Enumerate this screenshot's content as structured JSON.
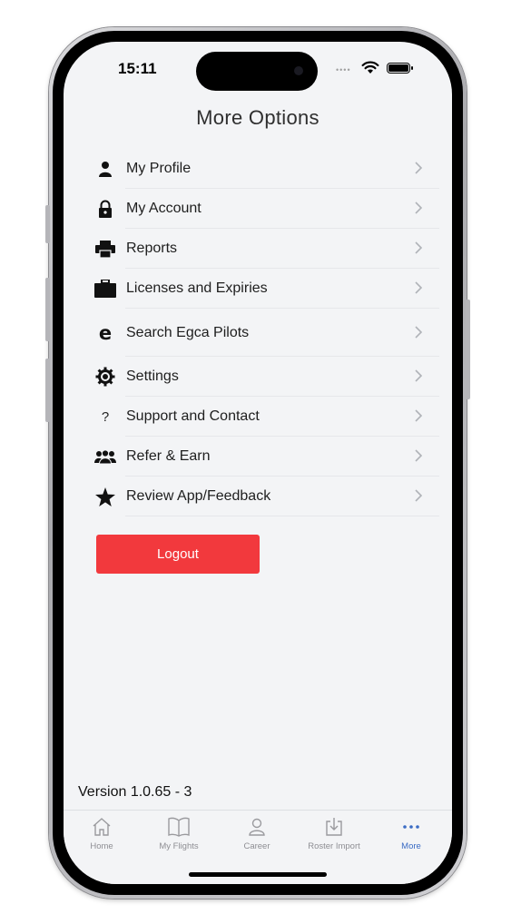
{
  "status_bar": {
    "time": "15:11",
    "signal": "••••"
  },
  "page": {
    "title": "More Options"
  },
  "menu": [
    {
      "label": "My Profile",
      "icon": "person-icon"
    },
    {
      "label": "My Account",
      "icon": "lock-icon"
    },
    {
      "label": "Reports",
      "icon": "printer-icon"
    },
    {
      "label": "Licenses and Expiries",
      "icon": "briefcase-icon"
    },
    {
      "label": "Search Egca Pilots",
      "icon": "egca-icon",
      "icon_text": "e"
    },
    {
      "label": "Settings",
      "icon": "gear-icon"
    },
    {
      "label": "Support and Contact",
      "icon": "question-icon",
      "icon_text": "?"
    },
    {
      "label": "Refer & Earn",
      "icon": "group-icon"
    },
    {
      "label": "Review App/Feedback",
      "icon": "star-icon"
    }
  ],
  "logout": {
    "label": "Logout",
    "color": "#f2393d"
  },
  "version": "Version 1.0.65 - 3",
  "tabs": [
    {
      "label": "Home",
      "icon": "home-icon"
    },
    {
      "label": "My Flights",
      "icon": "book-icon"
    },
    {
      "label": "Career",
      "icon": "person-outline-icon"
    },
    {
      "label": "Roster Import",
      "icon": "import-icon"
    },
    {
      "label": "More",
      "icon": "more-dots-icon",
      "active": true
    }
  ],
  "colors": {
    "accent": "#3a6bc4",
    "background": "#f3f4f6"
  }
}
